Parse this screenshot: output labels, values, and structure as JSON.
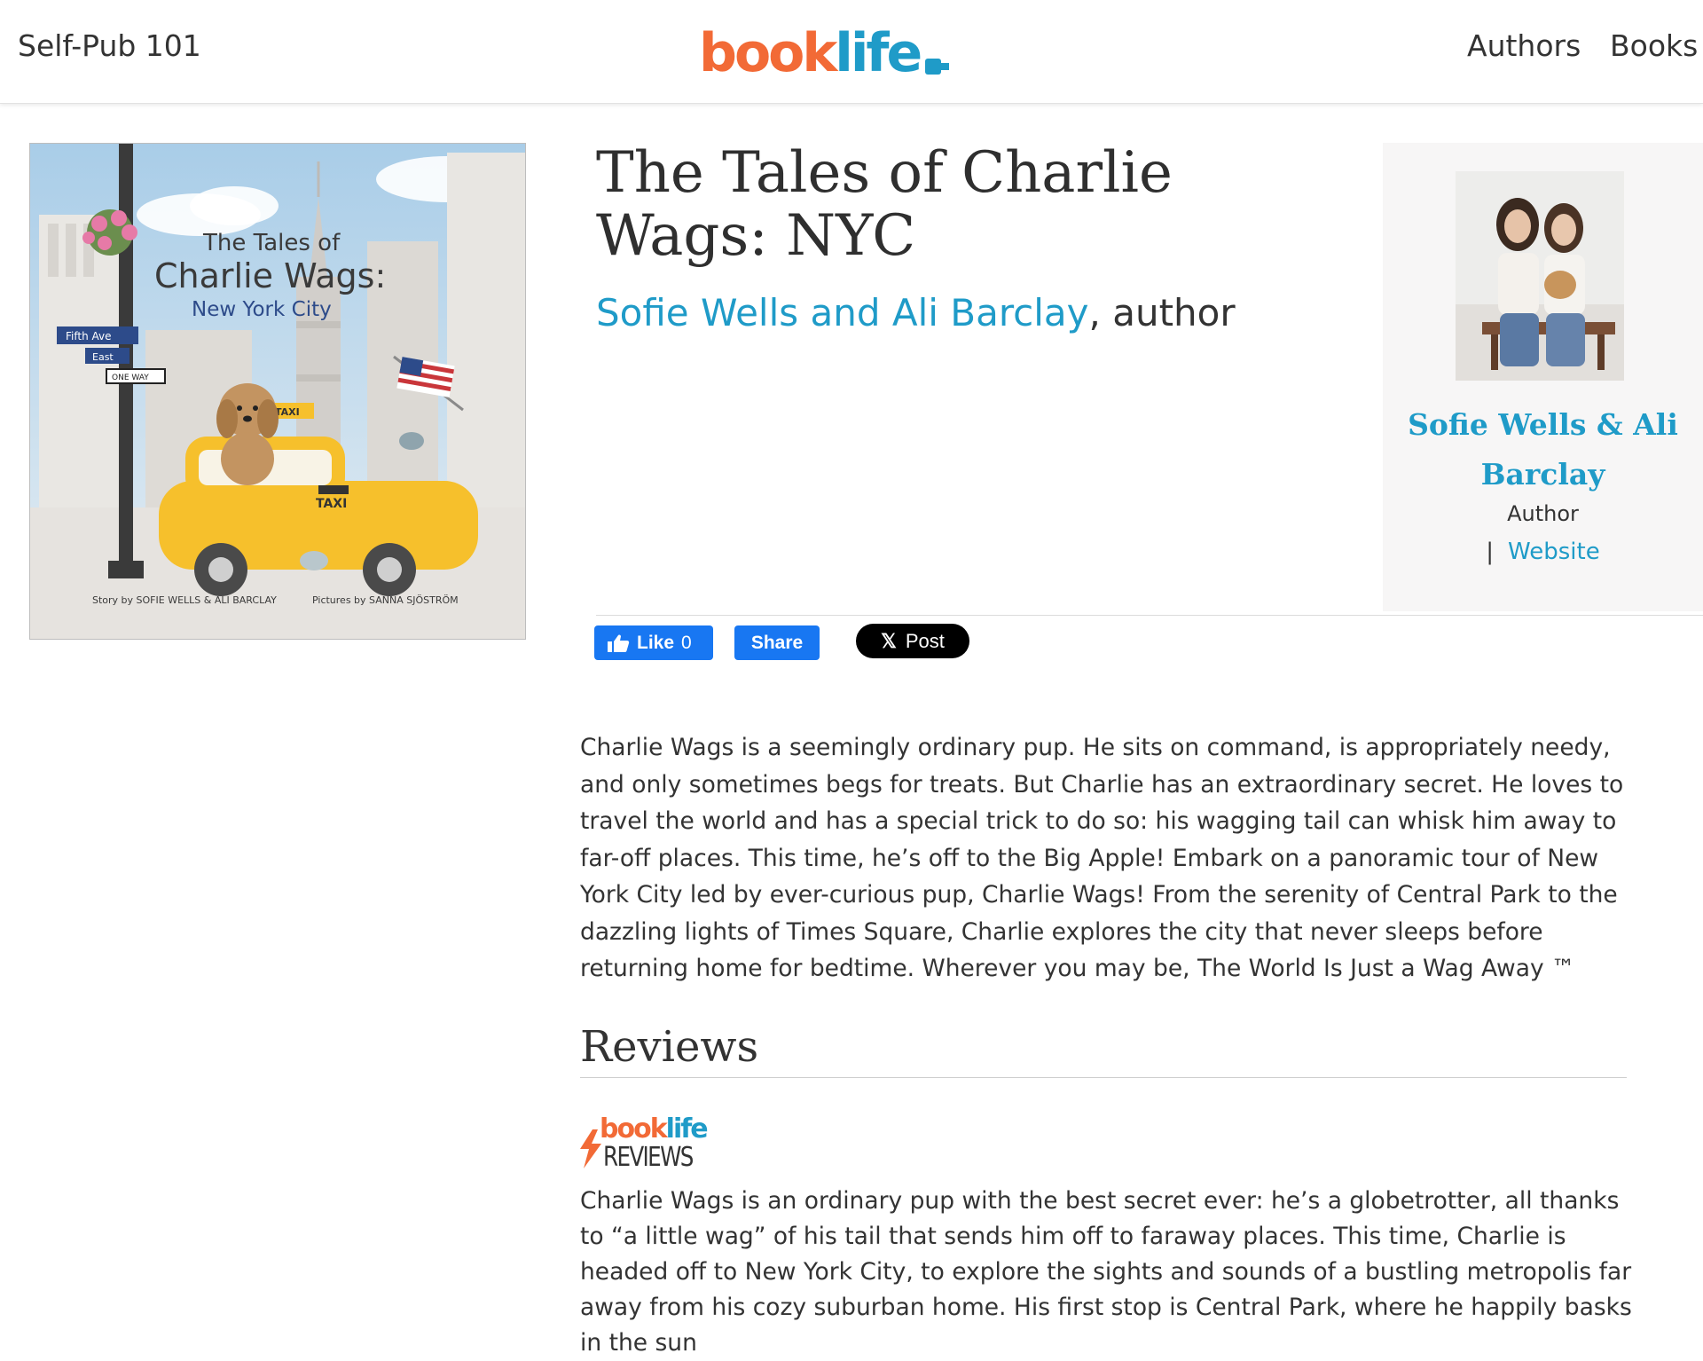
{
  "header": {
    "left_link": "Self-Pub 101",
    "logo": {
      "part1": "book",
      "part2": "life"
    },
    "nav": [
      {
        "label": "Authors"
      },
      {
        "label": "Books"
      }
    ]
  },
  "book": {
    "title": "The Tales of Charlie Wags: NYC",
    "author_link": "Sofie Wells and Ali Barclay",
    "author_suffix": ", author",
    "cover": {
      "title_line1": "The Tales of",
      "title_line2": "Charlie Wags:",
      "title_line3": "New York City",
      "sign1": "Fifth Ave",
      "sign2": "East",
      "sign3": "ONE WAY",
      "taxi_top": "TAXI",
      "taxi_door": "TAXI",
      "credits_story": "Story by  SOFIE WELLS  &  ALI BARCLAY",
      "credits_pictures": "Pictures by  SANNA SJÖSTRÖM"
    },
    "description": "Charlie Wags is a seemingly ordinary pup. He sits on command, is appropriately needy, and only sometimes begs for treats. But Charlie has an extraordinary secret. He loves to travel the world and has a special trick to do so: his wagging tail can whisk him away to far-off places. This time, he’s off to the Big Apple! Embark on a panoramic tour of New York City led by ever-curious pup, Charlie Wags! From the serenity of Central Park to the dazzling lights of Times Square, Charlie explores the city that never sleeps before returning home for bedtime. Wherever you may be, The World Is Just a Wag Away ™"
  },
  "author_card": {
    "name": "Sofie Wells & Ali Barclay",
    "role": "Author",
    "separator": "|",
    "website_label": "Website"
  },
  "social": {
    "like_label": "Like",
    "like_count": "0",
    "share_label": "Share",
    "post_label": "Post"
  },
  "reviews": {
    "heading": "Reviews",
    "logo_part1": "book",
    "logo_part2": "life",
    "logo_reviews": "REVIEWS",
    "text": "Charlie Wags is an ordinary pup with the best secret ever: he’s a globetrotter, all thanks to “a little wag” of his tail that sends him off to faraway places. This time, Charlie is headed off to New York City, to explore the sights and sounds of a bustling metropolis far away from his cozy suburban home. His first stop is Central Park, where he happily basks in the sun"
  },
  "colors": {
    "brand_orange": "#f26a36",
    "brand_blue": "#1f9bc8",
    "facebook_blue": "#1877f2",
    "x_black": "#000000"
  }
}
